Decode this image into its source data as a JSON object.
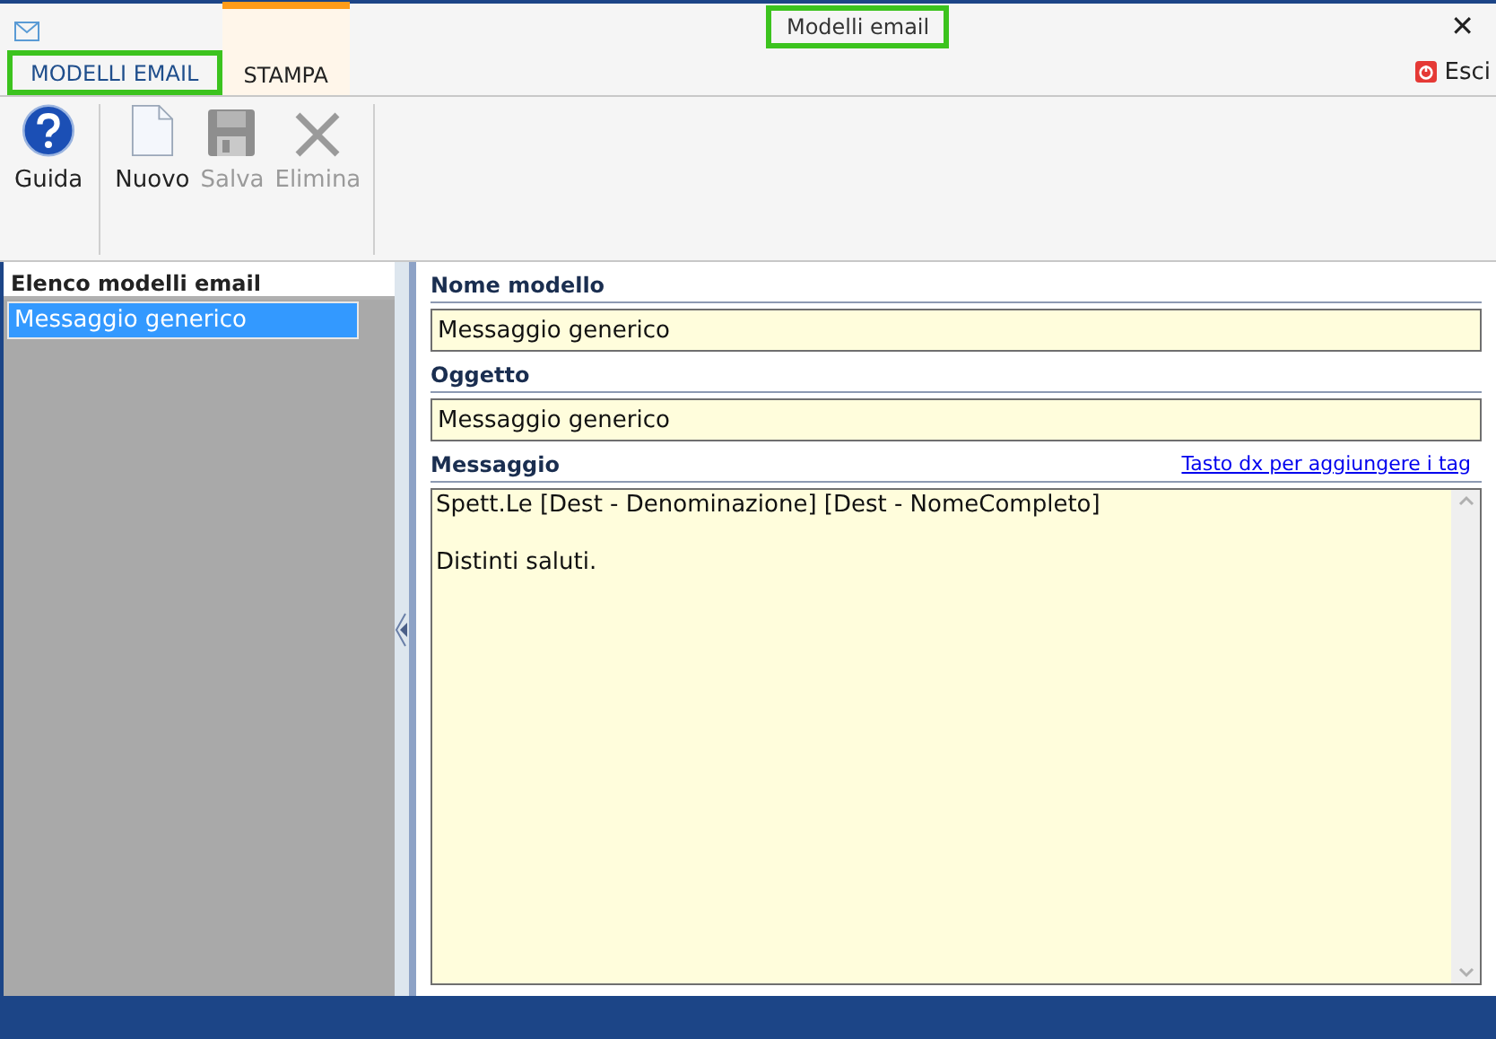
{
  "window": {
    "title": "Modelli email",
    "close": "✕"
  },
  "tabs": [
    {
      "label": "MODELLI EMAIL",
      "selected": true
    },
    {
      "label": "STAMPA",
      "selected": false
    }
  ],
  "exit_button": {
    "label": "Esci"
  },
  "toolbar": [
    {
      "kind": "help",
      "label": "Guida",
      "disabled": false
    },
    {
      "kind": "new",
      "label": "Nuovo",
      "disabled": false
    },
    {
      "kind": "save",
      "label": "Salva",
      "disabled": true
    },
    {
      "kind": "delete",
      "label": "Elimina",
      "disabled": true
    }
  ],
  "sidebar": {
    "title": "Elenco modelli email",
    "items": [
      {
        "label": "Messaggio generico",
        "selected": true
      }
    ]
  },
  "form": {
    "name": {
      "label": "Nome modello",
      "value": "Messaggio generico"
    },
    "subject": {
      "label": "Oggetto",
      "value": "Messaggio generico"
    },
    "message": {
      "label": "Messaggio",
      "hint_link": "Tasto dx per aggiungere i tag",
      "value": "Spett.Le [Dest - Denominazione] [Dest - NomeCompleto]\n\nDistinti saluti."
    }
  }
}
